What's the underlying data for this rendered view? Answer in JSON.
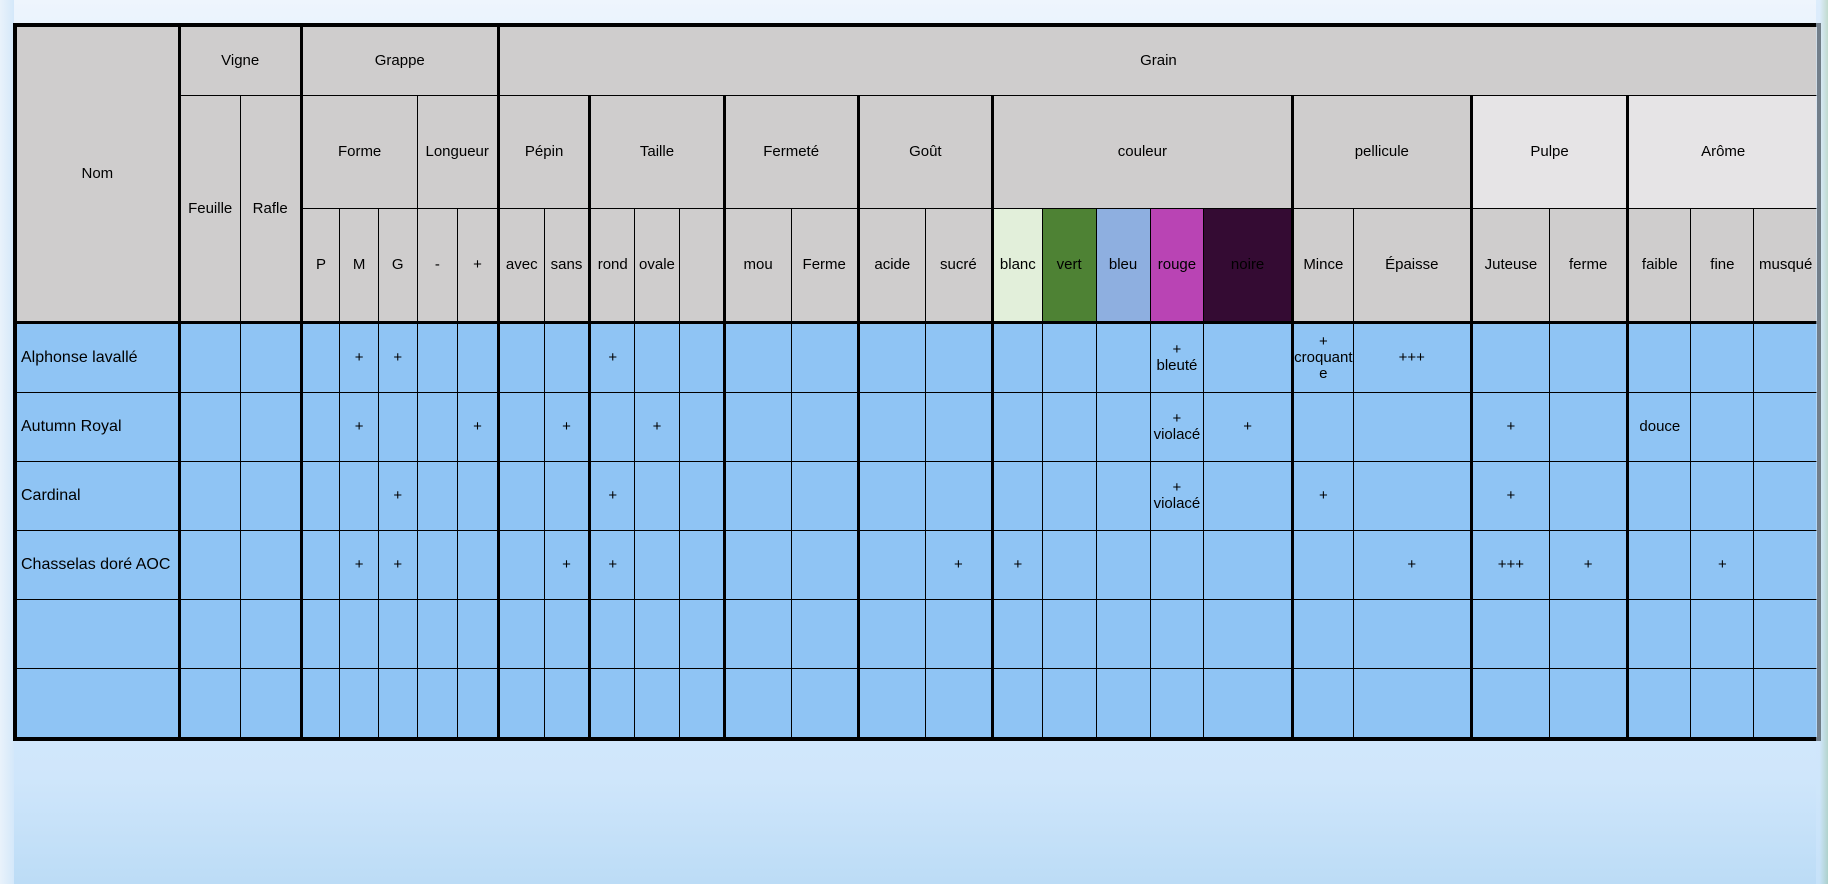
{
  "table": {
    "name_header": "Nom",
    "groups": [
      {
        "label": "Vigne",
        "span": 2
      },
      {
        "label": "Grappe",
        "span": 3
      },
      {
        "label": "Grain",
        "span": 20
      }
    ],
    "subgroups": [
      {
        "label": "Feuille",
        "span": 1,
        "rowspan": 2
      },
      {
        "label": "Rafle",
        "span": 1,
        "rowspan": 2
      },
      {
        "label": "Forme",
        "span": 3
      },
      {
        "label": "Longueur",
        "span": 2
      },
      {
        "label": "Pépin",
        "span": 2
      },
      {
        "label": "Taille",
        "span": 3
      },
      {
        "label": "Fermeté",
        "span": 2
      },
      {
        "label": "Goût",
        "span": 2
      },
      {
        "label": "couleur",
        "span": 5
      },
      {
        "label": "pellicule",
        "span": 2
      },
      {
        "label": "Pulpe",
        "span": 2
      },
      {
        "label": "Arôme",
        "span": 3
      }
    ],
    "leaves": [
      {
        "label": "P",
        "key": "forme_p"
      },
      {
        "label": "M",
        "key": "forme_m"
      },
      {
        "label": "G",
        "key": "forme_g"
      },
      {
        "label": "-",
        "key": "long_moins"
      },
      {
        "label": "+",
        "key": "long_plus"
      },
      {
        "label": "avec",
        "key": "pepin_avec"
      },
      {
        "label": "sans",
        "key": "pepin_sans"
      },
      {
        "label": "rond",
        "key": "taille_rond"
      },
      {
        "label": "ovale",
        "key": "taille_ovale"
      },
      {
        "label": "",
        "key": "taille_vide"
      },
      {
        "label": "mou",
        "key": "ferm_mou"
      },
      {
        "label": "Ferme",
        "key": "ferm_ferme"
      },
      {
        "label": "acide",
        "key": "gout_acide"
      },
      {
        "label": "sucré",
        "key": "gout_sucre"
      },
      {
        "label": "blanc",
        "key": "coul_blanc",
        "color": "#e2efda"
      },
      {
        "label": "vert",
        "key": "coul_vert",
        "color": "#4e8234"
      },
      {
        "label": "bleu",
        "key": "coul_bleu",
        "color": "#8eafe0"
      },
      {
        "label": "rouge",
        "key": "coul_rouge",
        "color": "#b944b4"
      },
      {
        "label": "noire",
        "key": "coul_noire",
        "color": "#340b33"
      },
      {
        "label": "Mince",
        "key": "pell_mince"
      },
      {
        "label": "Épaisse",
        "key": "pell_epaisse"
      },
      {
        "label": "Juteuse",
        "key": "pulpe_juteuse"
      },
      {
        "label": "ferme",
        "key": "pulpe_ferme"
      },
      {
        "label": "faible",
        "key": "arome_faible"
      },
      {
        "label": "fine",
        "key": "arome_fine"
      },
      {
        "label": "musqué",
        "key": "arome_musque"
      }
    ],
    "rows": [
      {
        "name": "Alphonse lavallé",
        "cells": [
          "",
          "",
          "",
          "+",
          "+",
          "",
          "",
          "",
          "",
          "+",
          "",
          "",
          "",
          "",
          "",
          "",
          "",
          "",
          "",
          "+ bleuté",
          "",
          "+ croquante",
          "+++",
          "",
          "",
          "",
          ""
        ]
      },
      {
        "name": "Autumn Royal",
        "cells": [
          "",
          "",
          "",
          "+",
          "",
          "",
          "+",
          "",
          "+",
          "",
          "+",
          "",
          "",
          "",
          "",
          "",
          "",
          "",
          "",
          "+ violacé",
          "+",
          "",
          "",
          "+",
          "",
          "douce",
          ""
        ]
      },
      {
        "name": "Cardinal",
        "cells": [
          "",
          "",
          "",
          "",
          "+",
          "",
          "",
          "",
          "",
          "+",
          "",
          "",
          "",
          "",
          "",
          "",
          "",
          "",
          "",
          "+ violacé",
          "",
          "+",
          "",
          "+",
          "",
          "",
          ""
        ]
      },
      {
        "name": "Chasselas doré AOC",
        "cells": [
          "",
          "",
          "",
          "+",
          "+",
          "",
          "",
          "",
          "+",
          "+",
          "",
          "",
          "",
          "",
          "",
          "+",
          "+",
          "",
          "",
          "",
          "",
          "",
          "+",
          "+++",
          "+",
          "",
          "+"
        ]
      },
      {
        "name": "",
        "cells": [
          "",
          "",
          "",
          "",
          "",
          "",
          "",
          "",
          "",
          "",
          "",
          "",
          "",
          "",
          "",
          "",
          "",
          "",
          "",
          "",
          "",
          "",
          "",
          "",
          "",
          "",
          ""
        ]
      },
      {
        "name": "",
        "cells": [
          "",
          "",
          "",
          "",
          "",
          "",
          "",
          "",
          "",
          "",
          "",
          "",
          "",
          "",
          "",
          "",
          "",
          "",
          "",
          "",
          "",
          "",
          "",
          "",
          "",
          "",
          ""
        ]
      }
    ]
  },
  "colors": {
    "header_gray": "#cfcdcd",
    "header_light_gray": "#e6e4e6",
    "data_blue": "#8fc4f4",
    "page_background": "#dceeff",
    "blanc": "#e2efda",
    "vert": "#4e8234",
    "bleu": "#8eafe0",
    "rouge": "#b944b4",
    "noire": "#340b33"
  }
}
